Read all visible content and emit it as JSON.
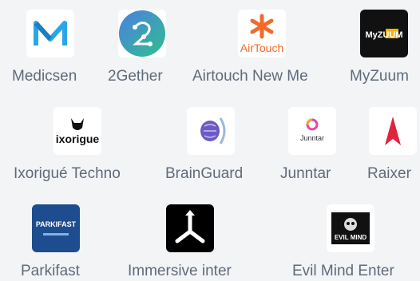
{
  "colors": {
    "background": "#f3f4f6",
    "label_text": "#5f6b7a",
    "medicsen_blue": "#29a6e8",
    "twogether_gradient": [
      "#4c7fe2",
      "#2fbf8e"
    ],
    "airtouch_orange": "#f26a2a",
    "myzuum_bg": "#111111",
    "myzuum_accent": "#f5b400",
    "raixer_red": "#e0243a",
    "parkifast_blue": "#1d4c8f",
    "brainguard_purple": "#6a5bc7"
  },
  "apps": [
    {
      "name": "Medicsen",
      "icon": "medicsen-logo-icon"
    },
    {
      "name": "2Gether",
      "icon": "2gether-logo-icon"
    },
    {
      "name": "Airtouch New Me",
      "icon": "airtouch-logo-icon",
      "logo_text": "AirTouch"
    },
    {
      "name": "MyZuum",
      "icon": "myzuum-logo-icon",
      "logo_text": "MyZUUM"
    },
    {
      "name": "Ixorigué Techno",
      "icon": "ixorigue-logo-icon",
      "logo_text": "ixorigue"
    },
    {
      "name": "BrainGuard",
      "icon": "brainguard-logo-icon"
    },
    {
      "name": "Junntar",
      "icon": "junntar-logo-icon",
      "logo_text": "Junntar"
    },
    {
      "name": "Raixer",
      "icon": "raixer-logo-icon"
    },
    {
      "name": "Parkifast",
      "icon": "parkifast-logo-icon",
      "logo_text": "PARKIFAST"
    },
    {
      "name": "Immersive inter",
      "icon": "immersive-logo-icon"
    },
    {
      "name": "Evil Mind Enter",
      "icon": "evil-mind-logo-icon",
      "logo_text": "EVIL MIND"
    }
  ]
}
